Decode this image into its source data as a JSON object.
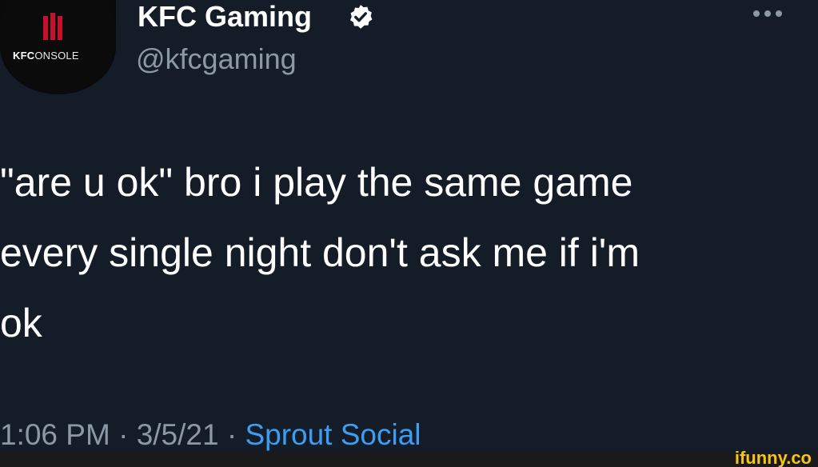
{
  "author": {
    "display_name": "KFC Gaming",
    "handle": "@kfcgaming",
    "avatar_brand_bold": "KFC",
    "avatar_brand_light": "ONSOLE",
    "verified_icon": "verified-badge-icon"
  },
  "tweet": {
    "text": "\"are u ok\" bro i play the same game\nevery single night don't ask me if i'm\nok"
  },
  "meta": {
    "time": "1:06 PM",
    "separator": " · ",
    "date": "3/5/21",
    "source": "Sprout Social"
  },
  "watermark": {
    "text": "ifunny.co"
  },
  "colors": {
    "background": "#141c27",
    "secondary_text": "#8b98a5",
    "link": "#3d9df2",
    "kfc_red": "#c8102e",
    "watermark": "#f5c518"
  }
}
